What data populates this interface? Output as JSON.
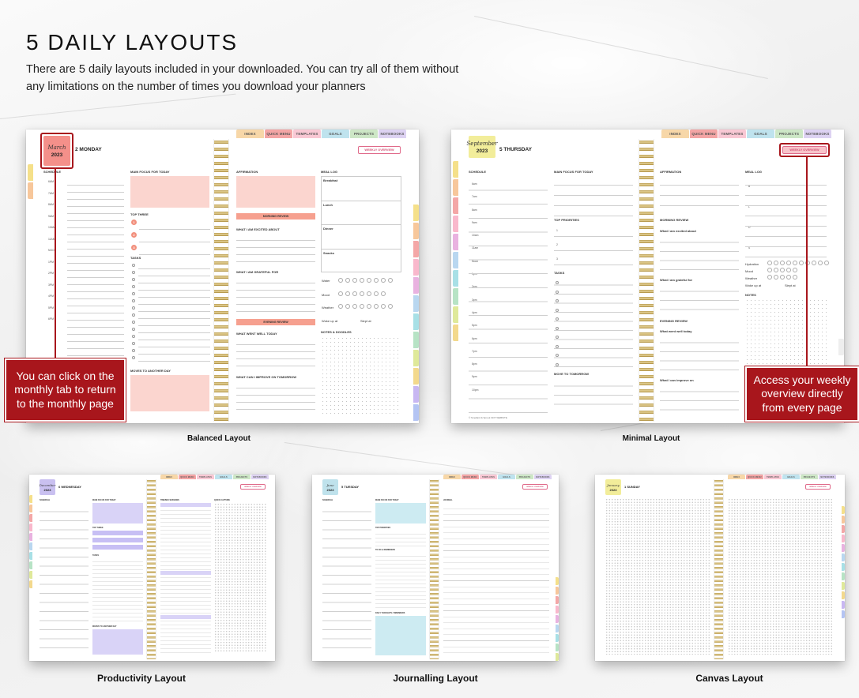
{
  "header": {
    "title": "5 DAILY LAYOUTS",
    "subtitle": "There are 5 daily layouts included in your downloaded. You can try all of them without any limitations on the number of times you download your planners"
  },
  "tabs": [
    "INDEX",
    "QUICK MENU",
    "TEMPLATES",
    "GOALS",
    "PROJECTS",
    "NOTEBOOKS"
  ],
  "tab_colors": [
    "#f7d7a8",
    "#f4a5a5",
    "#f9c8d4",
    "#bfe3ee",
    "#cde7c6",
    "#ddd2f2"
  ],
  "month_tab_colors": [
    "#f5e08a",
    "#f7c79b",
    "#f4a7a7",
    "#f9b8cc",
    "#e9b2e0",
    "#b9d7f0",
    "#a8e0e6",
    "#b7e3c5",
    "#dfe99a",
    "#f3d98d",
    "#c8b7f2",
    "#b4c4f3"
  ],
  "balanced": {
    "caption": "Balanced Layout",
    "month": "March",
    "year": "2023",
    "day": "2  MONDAY",
    "weekly_btn": "WEEKLY OVERVIEW",
    "sections": {
      "schedule": "SCHEDULE",
      "main_focus": "MAIN FOCUS FOR TODAY",
      "top_three": "TOP THREE",
      "tasks": "TASKS",
      "moves": "MOVES TO ANOTHER DAY",
      "affirmation": "AFFIRMATION",
      "morning_review": "MORNING REVIEW",
      "excited": "WHAT I AM EXCITED ABOUT",
      "grateful": "WHAT I AM GRATEFUL FOR",
      "evening_review": "EVENING REVIEW",
      "went_well": "WHAT WENT WELL TODAY",
      "improve": "WHAT CAN I IMPROVE ON TOMORROW",
      "meal_log": "MEAL LOG",
      "meals": [
        "Breakfast",
        "Lunch",
        "Dinner",
        "Snacks"
      ],
      "water": "Water",
      "mood": "Mood",
      "weather": "Weather",
      "woke_up": "Woke up at",
      "slept": "Slept at",
      "notes": "NOTES & DOODLES"
    },
    "hours": [
      "6AM",
      "7AM",
      "8AM",
      "9AM",
      "10AM",
      "11AM",
      "NOON",
      "1PM",
      "2PM",
      "3PM",
      "4PM",
      "5PM",
      "6PM"
    ],
    "top_three_numbers": [
      "1",
      "2",
      "3"
    ],
    "callout": "You can click on the monthly tab to return to the monthly page"
  },
  "minimal": {
    "caption": "Minimal Layout",
    "month": "September",
    "year": "2023",
    "day": "5  THURSDAY",
    "weekly_btn": "WEEKLY OVERVIEW",
    "sections": {
      "schedule": "SCHEDULE",
      "main_focus": "MAIN FOCUS FOR TODAY",
      "top_priorities": "TOP PRIORITIES",
      "tasks": "TASKS",
      "move": "MOVE TO TOMORROW",
      "affirmation": "AFFIRMATION",
      "morning_review": "MORNING REVIEW",
      "excited": "What I am excited about",
      "grateful": "What I am grateful for",
      "evening_review": "EVENING REVIEW",
      "went_well": "What went well today",
      "improve": "What I can improve on",
      "meal_log": "MEAL LOG",
      "meal_letters": [
        "B",
        "L",
        "D",
        "S"
      ],
      "hydration": "Hydration",
      "mood": "Mood",
      "weather": "Weather",
      "woke_up": "Woke up at",
      "slept": "Slept at",
      "notes": "NOTES"
    },
    "hours": [
      "6am",
      "7am",
      "8am",
      "9am",
      "10am",
      "11am",
      "Noon",
      "1pm",
      "2pm",
      "3pm",
      "4pm",
      "5pm",
      "6pm",
      "7pm",
      "8pm",
      "9pm",
      "10pm"
    ],
    "priority_numbers": [
      "1",
      "2",
      "3"
    ],
    "footer": "© Smellard & Sprout  NOT WEBSITE",
    "callout": "Access your weekly overview directly from every page"
  },
  "productivity": {
    "caption": "Productivity Layout",
    "month": "December",
    "year": "2023",
    "day": "6  WEDNESDAY",
    "weekly_btn": "WEEKLY OVERVIEW",
    "sections": {
      "schedule": "SCHEDULE",
      "main_focus": "MAIN FOCUS FOR TODAY",
      "top_three": "TOP THREE",
      "tasks": "TASKS",
      "moves": "MOVES TO ANOTHER DAY",
      "col3": "TIMEBOX SESSIONS",
      "col4": "QUICK CAPTURE"
    }
  },
  "journalling": {
    "caption": "Journalling Layout",
    "month": "June",
    "year": "2023",
    "day": "5  TUESDAY",
    "weekly_btn": "WEEKLY OVERVIEW",
    "sections": {
      "schedule": "SCHEDULE",
      "main_focus": "MAIN FOCUS FOR TODAY",
      "top_priorities": "TOP PRIORITIES",
      "todo": "TO DO & REMINDERS",
      "daily_thoughts": "DAILY THOUGHTS / REMINDERS",
      "journal": "JOURNAL"
    }
  },
  "canvas": {
    "caption": "Canvas Layout",
    "month": "January",
    "year": "2023",
    "day": "1  SUNDAY",
    "weekly_btn": "WEEKLY OVERVIEW"
  }
}
